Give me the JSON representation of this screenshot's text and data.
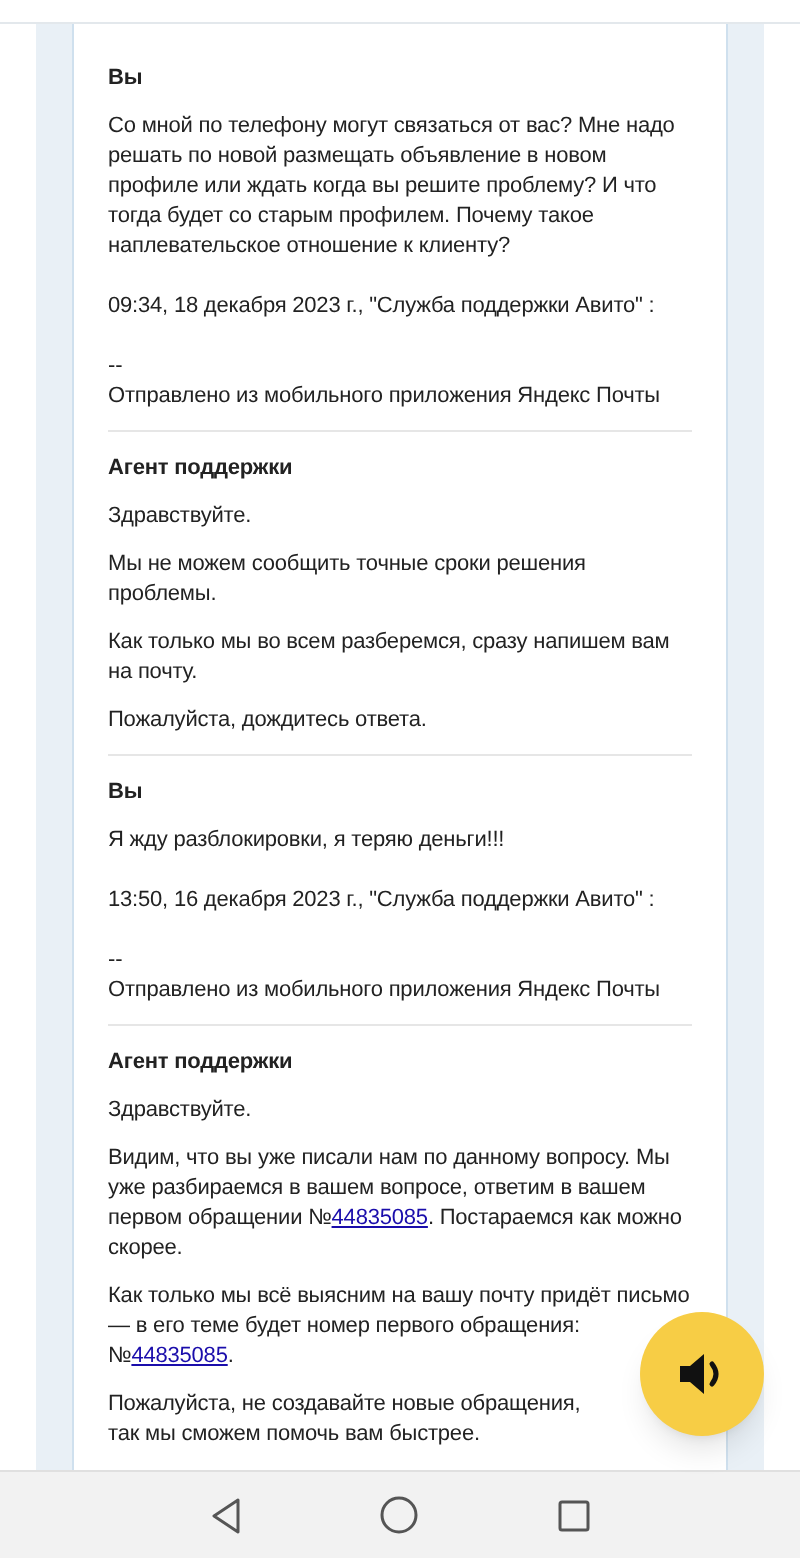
{
  "messages": [
    {
      "author": "Вы",
      "paragraphs": [
        {
          "kind": "text",
          "lines": [
            "Со мной по телефону могут связаться от вас? Мне надо решать по новой размещать объявление в новом профиле или ждать когда вы решите проблему? И что тогда будет со старым профилем. Почему такое наплевательское отношение к клиенту?"
          ]
        },
        {
          "kind": "spacer"
        },
        {
          "kind": "text",
          "lines": [
            "09:34, 18 декабря 2023 г., \"Служба поддержки Авито\" :"
          ]
        },
        {
          "kind": "spacer"
        },
        {
          "kind": "text",
          "lines": [
            "--",
            "Отправлено из мобильного приложения Яндекс Почты"
          ]
        }
      ]
    },
    {
      "author": "Агент поддержки",
      "paragraphs": [
        {
          "kind": "text",
          "lines": [
            "Здравствуйте."
          ]
        },
        {
          "kind": "text",
          "lines": [
            "Мы не можем сообщить точные сроки решения проблемы."
          ]
        },
        {
          "kind": "text",
          "lines": [
            "Как только мы во всем разберемся, сразу напишем вам на почту."
          ]
        },
        {
          "kind": "text",
          "lines": [
            "Пожалуйста, дождитесь ответа."
          ]
        }
      ]
    },
    {
      "author": "Вы",
      "paragraphs": [
        {
          "kind": "text",
          "lines": [
            "Я жду разблокировки, я теряю деньги!!!"
          ]
        },
        {
          "kind": "spacer"
        },
        {
          "kind": "text",
          "lines": [
            "13:50, 16 декабря 2023 г., \"Служба поддержки Авито\" :"
          ]
        },
        {
          "kind": "spacer"
        },
        {
          "kind": "text",
          "lines": [
            "--",
            "Отправлено из мобильного приложения Яндекс Почты"
          ]
        }
      ]
    },
    {
      "author": "Агент поддержки",
      "paragraphs": [
        {
          "kind": "text",
          "lines": [
            "Здравствуйте."
          ]
        },
        {
          "kind": "parts",
          "parts": [
            {
              "kind": "text",
              "text": "Видим, что вы уже писали нам по данному вопросу. Мы уже разбираемся в вашем вопросе, ответим в вашем первом обращении №"
            },
            {
              "kind": "link",
              "text": "44835085"
            },
            {
              "kind": "text",
              "text": ". Постараемся как можно скорее."
            }
          ]
        },
        {
          "kind": "parts",
          "parts": [
            {
              "kind": "text",
              "text": "Как только мы всё выясним на вашу почту придёт письмо — в его теме будет номер первого обращения: №"
            },
            {
              "kind": "link",
              "text": "44835085"
            },
            {
              "kind": "text",
              "text": "."
            }
          ]
        },
        {
          "kind": "text",
          "lines": [
            "Пожалуйста, не создавайте новые обращения, так мы сможем помочь вам быстрее."
          ]
        }
      ]
    }
  ]
}
